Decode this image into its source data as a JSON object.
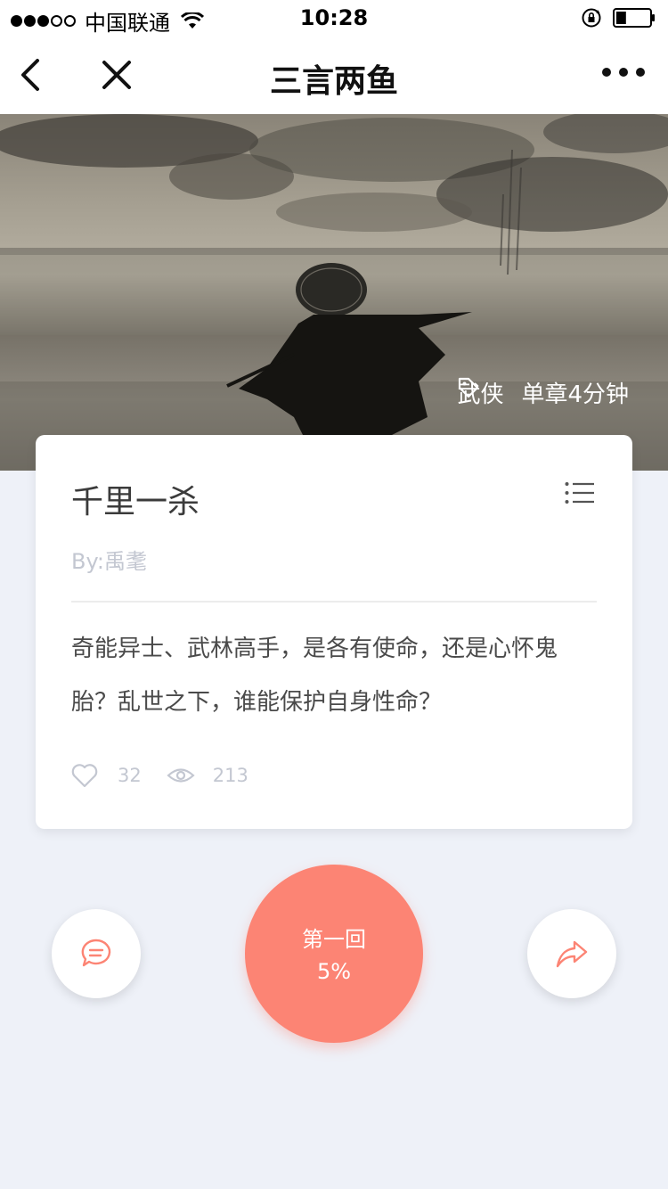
{
  "status_bar": {
    "carrier": "中国联通",
    "time": "10:28",
    "signal_icon": "signal-dots-icon",
    "wifi_icon": "wifi-icon",
    "rotation_icon": "rotation-lock-icon",
    "battery_icon": "battery-icon",
    "battery_level": 0.3
  },
  "nav": {
    "title": "三言两鱼",
    "back_icon": "chevron-left-icon",
    "close_icon": "close-icon",
    "more_icon": "more-dots-icon"
  },
  "hero": {
    "tag_icon": "tag-icon",
    "genre": "武侠",
    "duration": "单章4分钟"
  },
  "story": {
    "title": "千里一杀",
    "author": "By:禹耄",
    "description": "奇能异士、武林高手，是各有使命，还是心怀鬼胎？乱世之下，谁能保护自身性命？",
    "likes": "32",
    "views": "213",
    "menu_icon": "list-menu-icon",
    "heart_icon": "heart-icon",
    "eye_icon": "eye-icon"
  },
  "actions": {
    "chapter": "第一回",
    "progress": "5%",
    "comment_icon": "comment-icon",
    "share_icon": "share-icon"
  },
  "colors": {
    "accent": "#fc8474",
    "background": "#eef1f8",
    "muted_text": "#c3c7d1"
  }
}
